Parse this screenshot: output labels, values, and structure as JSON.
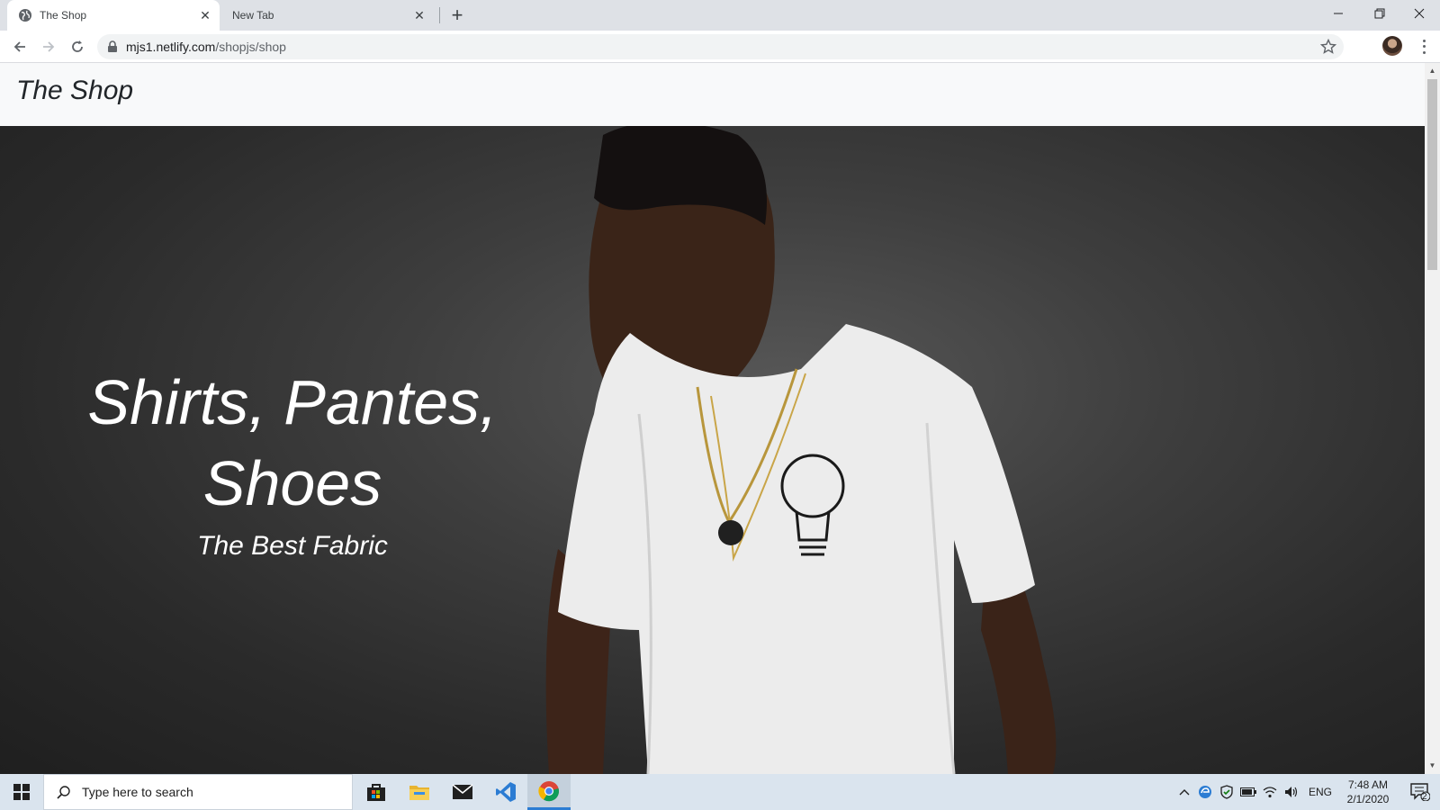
{
  "browser": {
    "tabs": [
      {
        "title": "The Shop",
        "active": true
      },
      {
        "title": "New Tab",
        "active": false
      }
    ],
    "url_host": "mjs1.netlify.com",
    "url_path": "/shopjs/shop"
  },
  "site": {
    "brand": "The Shop",
    "hero_title_line1": "Shirts, Pantes,",
    "hero_title_line2": "Shoes",
    "hero_subtitle": "The Best Fabric"
  },
  "taskbar": {
    "search_placeholder": "Type here to search",
    "language": "ENG",
    "time": "7:48 AM",
    "date": "2/1/2020",
    "notification_count": "2"
  },
  "colors": {
    "tabstrip": "#dee1e6",
    "hero_bg": "#3e3e3e",
    "taskbar": "#dae4ee",
    "accent": "#2b7cd3"
  }
}
